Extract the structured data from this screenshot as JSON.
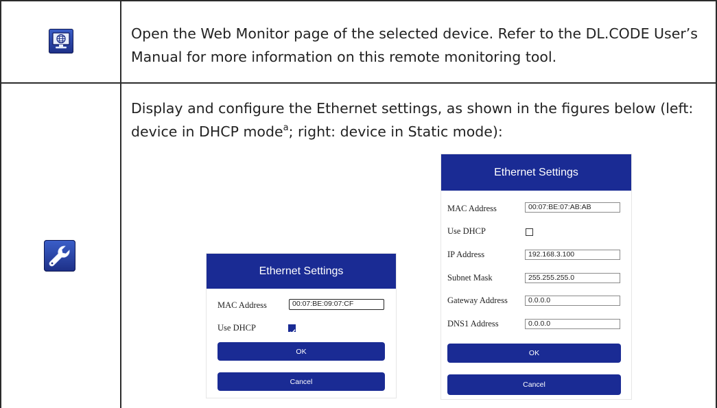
{
  "rows": [
    {
      "icon": "web-monitor-icon",
      "text": "Open the Web Monitor page of the selected device. Refer to the DL.CODE User’s Manual for more information on this remote monitoring tool."
    },
    {
      "icon": "wrench-icon",
      "text_before": "Display and configure the Ethernet settings, as shown in the figures below (left: device in DHCP mode",
      "footnote": "a",
      "text_after": "; right: device in Static mode):"
    }
  ],
  "dhcp_dialog": {
    "title": "Ethernet Settings",
    "mac_label": "MAC Address",
    "mac_value": "00:07:BE:09:07:CF",
    "dhcp_label": "Use DHCP",
    "dhcp_checked": true,
    "ok_label": "OK",
    "cancel_label": "Cancel"
  },
  "static_dialog": {
    "title": "Ethernet Settings",
    "mac_label": "MAC Address",
    "mac_value": "00:07:BE:07:AB:AB",
    "dhcp_label": "Use DHCP",
    "dhcp_checked": false,
    "ip_label": "IP Address",
    "ip_value": "192.168.3.100",
    "subnet_label": "Subnet Mask",
    "subnet_value": "255.255.255.0",
    "gateway_label": "Gateway Address",
    "gateway_value": "0.0.0.0",
    "dns_label": "DNS1 Address",
    "dns_value": "0.0.0.0",
    "ok_label": "OK",
    "cancel_label": "Cancel"
  },
  "colors": {
    "accent": "#1a2b94",
    "border": "#2b2b2b"
  }
}
